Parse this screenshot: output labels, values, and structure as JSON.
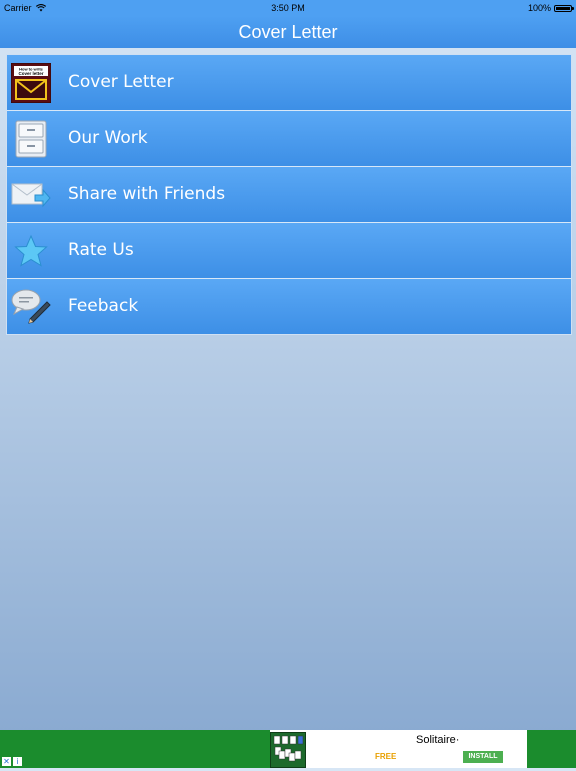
{
  "status_bar": {
    "carrier": "Carrier",
    "time": "3:50 PM",
    "battery": "100%"
  },
  "nav": {
    "title": "Cover Letter"
  },
  "menu": {
    "items": [
      {
        "label": "Cover Letter",
        "icon": "cover-letter-envelope-icon",
        "icon_text": "How to write Cover letter"
      },
      {
        "label": "Our Work",
        "icon": "drawer-cabinet-icon"
      },
      {
        "label": "Share with Friends",
        "icon": "share-envelope-icon"
      },
      {
        "label": "Rate Us",
        "icon": "star-icon"
      },
      {
        "label": "Feeback",
        "icon": "chat-pencil-icon"
      }
    ]
  },
  "ad": {
    "title": "Solitaire·",
    "price": "FREE",
    "install_label": "INSTALL",
    "close": "✕",
    "info": "i"
  },
  "colors": {
    "accent": "#4ea0f2",
    "row": "#3d8fe6",
    "ad_green": "#1b8c2d"
  }
}
